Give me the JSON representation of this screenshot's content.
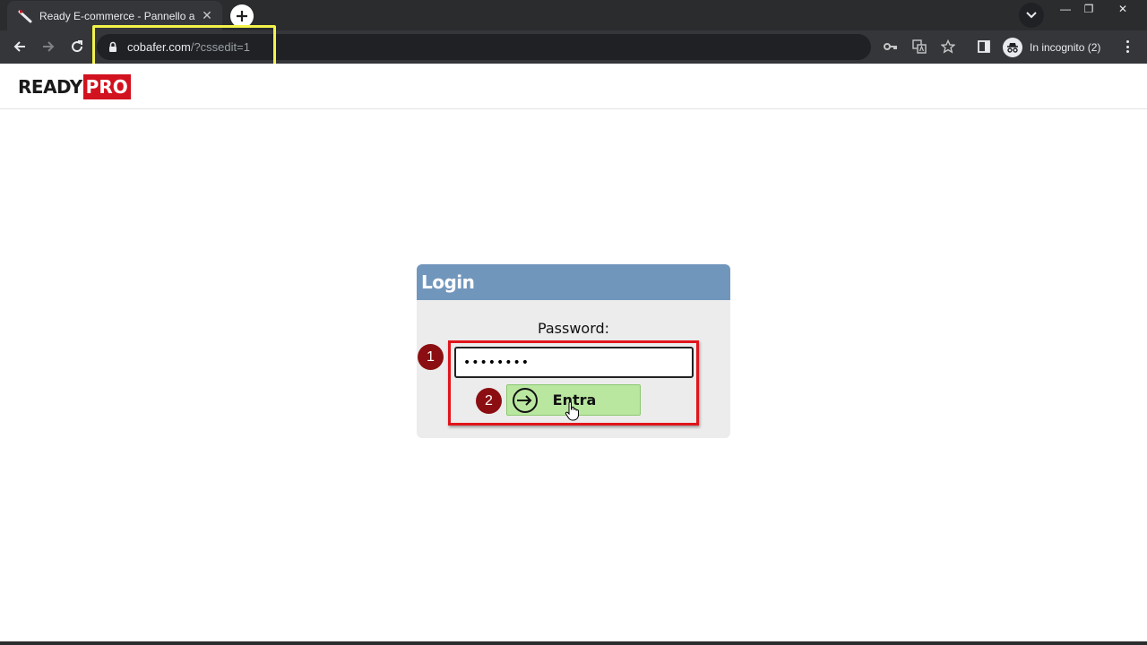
{
  "browser": {
    "tab": {
      "title": "Ready E-commerce - Pannello amministrazione",
      "close_label": "✕"
    },
    "new_tab_label": "+",
    "window_controls": {
      "minimize": "—",
      "restore": "❐",
      "close": "✕"
    },
    "url": {
      "host": "cobafer.com",
      "path": "/?cssedit=1"
    },
    "incognito_label": "In incognito (2)"
  },
  "page": {
    "logo": {
      "ready": "READY",
      "pro": "PRO"
    },
    "login": {
      "title": "Login",
      "password_label": "Password:",
      "password_value": "••••••••",
      "submit_label": "Entra"
    },
    "annotations": {
      "step1": "1",
      "step2": "2"
    }
  },
  "colors": {
    "header_blue": "#7196bc",
    "button_green": "#b9e7a0",
    "annotation_red": "#e0151b",
    "badge_dark_red": "#8b0f12",
    "url_highlight_yellow": "#f2f24a",
    "logo_red": "#d3121f"
  }
}
